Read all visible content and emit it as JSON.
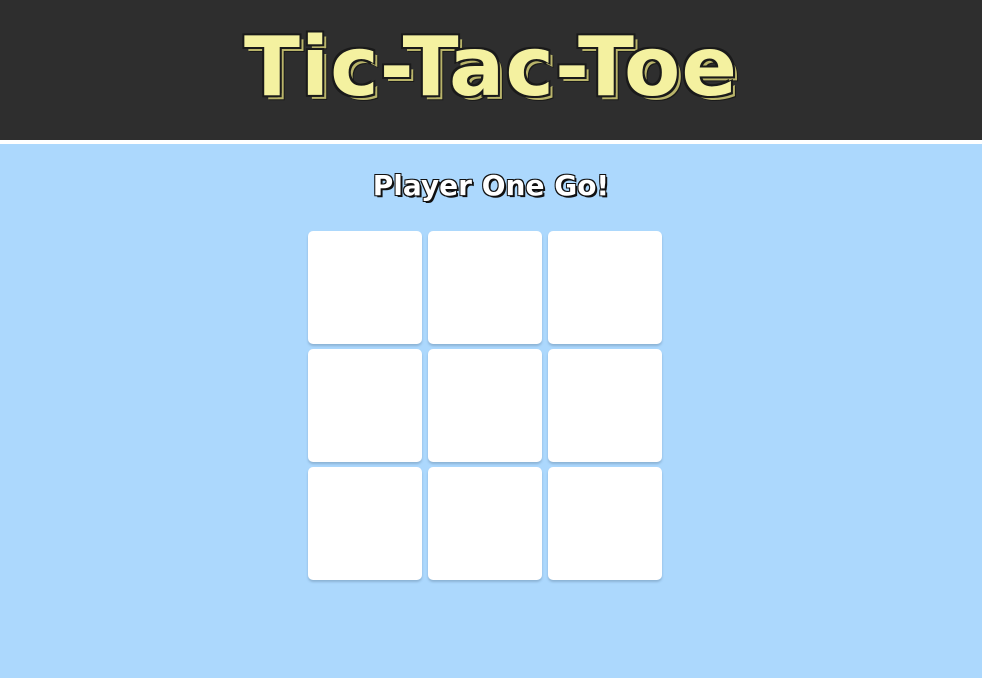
{
  "header": {
    "title": "Tic-Tac-Toe"
  },
  "status": {
    "message": "Player One Go!"
  },
  "board": {
    "cells": [
      "",
      "",
      "",
      "",
      "",
      "",
      "",
      "",
      ""
    ]
  },
  "colors": {
    "header_background": "#2e2e2e",
    "title_text": "#f4f1a0",
    "page_background": "#acd8fd",
    "cell_background": "#ffffff"
  }
}
